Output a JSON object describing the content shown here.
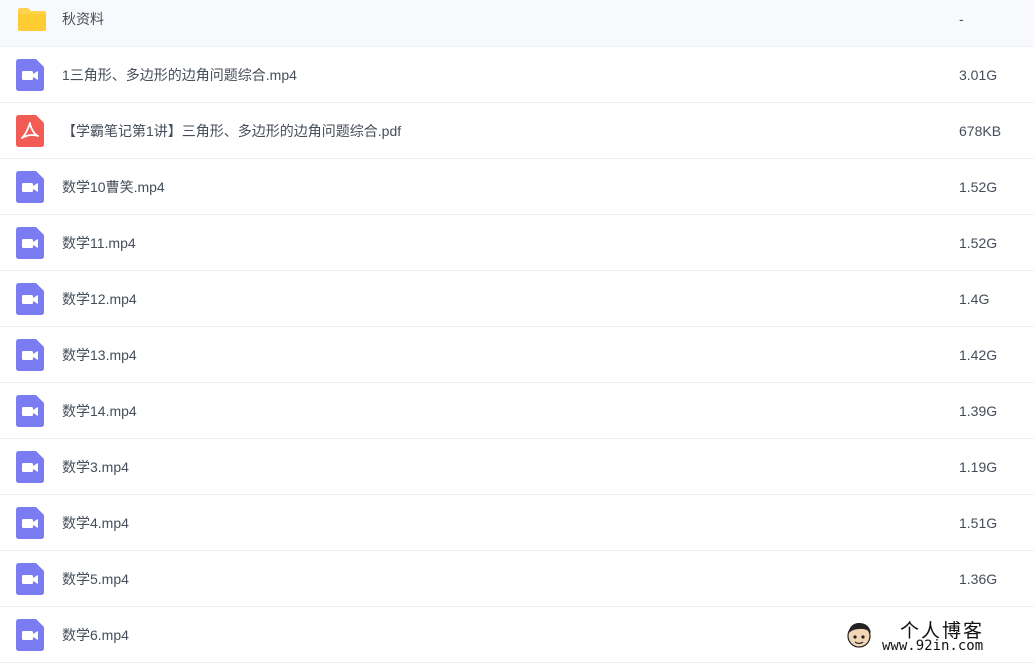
{
  "files": [
    {
      "name": "秋资料",
      "size": "-",
      "type": "folder",
      "icon": "folder-icon"
    },
    {
      "name": "1三角形、多边形的边角问题综合.mp4",
      "size": "3.01G",
      "type": "video",
      "icon": "video-icon"
    },
    {
      "name": "【学霸笔记第1讲】三角形、多边形的边角问题综合.pdf",
      "size": "678KB",
      "type": "pdf",
      "icon": "pdf-icon"
    },
    {
      "name": "数学10曹笑.mp4",
      "size": "1.52G",
      "type": "video",
      "icon": "video-icon"
    },
    {
      "name": "数学11.mp4",
      "size": "1.52G",
      "type": "video",
      "icon": "video-icon"
    },
    {
      "name": "数学12.mp4",
      "size": "1.4G",
      "type": "video",
      "icon": "video-icon"
    },
    {
      "name": "数学13.mp4",
      "size": "1.42G",
      "type": "video",
      "icon": "video-icon"
    },
    {
      "name": "数学14.mp4",
      "size": "1.39G",
      "type": "video",
      "icon": "video-icon"
    },
    {
      "name": "数学3.mp4",
      "size": "1.19G",
      "type": "video",
      "icon": "video-icon"
    },
    {
      "name": "数学4.mp4",
      "size": "1.51G",
      "type": "video",
      "icon": "video-icon"
    },
    {
      "name": "数学5.mp4",
      "size": "1.36G",
      "type": "video",
      "icon": "video-icon"
    },
    {
      "name": "数学6.mp4",
      "size": "",
      "type": "video",
      "icon": "video-icon"
    }
  ],
  "colors": {
    "folder": "#ffd24d",
    "video": "#7b7cf2",
    "pdf": "#f25c54"
  },
  "watermark": {
    "title": "个人博客",
    "url": "www.92in.com"
  }
}
